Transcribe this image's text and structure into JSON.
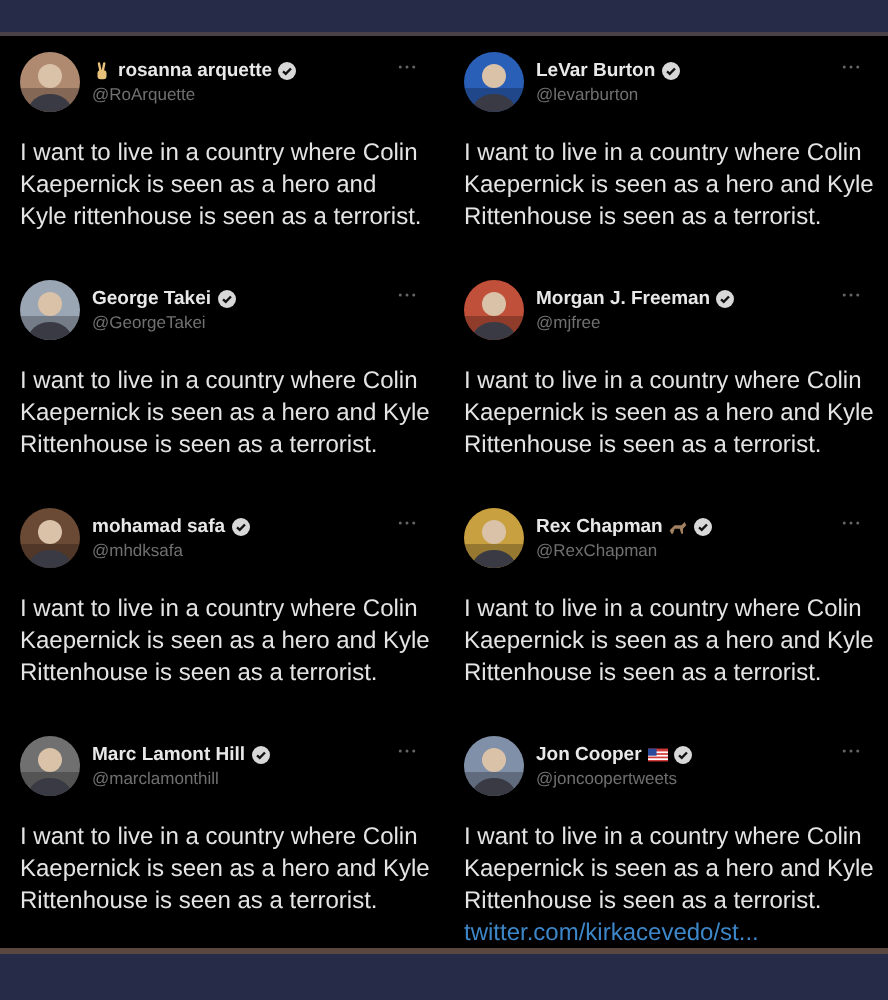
{
  "tweets": [
    {
      "kind": "peace",
      "name": "rosanna arquette",
      "handle": "@RoArquette",
      "text": "I want to live in a country where Colin\nKaepernick  is seen as a hero and\nKyle rittenhouse is seen as a terrorist."
    },
    {
      "kind": "plain",
      "name": "LeVar Burton",
      "handle": "@levarburton",
      "text": "I want to live in a country where Colin\nKaepernick is seen as a hero and Kyle\nRittenhouse is seen as a terrorist."
    },
    {
      "kind": "plain",
      "name": "George Takei",
      "handle": "@GeorgeTakei",
      "text": "I want to live in a country where Colin\nKaepernick is seen as a hero and Kyle\nRittenhouse is seen as a terrorist."
    },
    {
      "kind": "plain",
      "name": "Morgan J. Freeman",
      "handle": "@mjfree",
      "text": "I want to live in a country where Colin\nKaepernick is seen as a hero and Kyle\nRittenhouse is seen as a terrorist."
    },
    {
      "kind": "plain",
      "name": "mohamad safa",
      "handle": "@mhdksafa",
      "text": "I want to live in a country where Colin\nKaepernick is seen as a hero and Kyle\nRittenhouse is seen as a terrorist."
    },
    {
      "kind": "horse",
      "name": "Rex Chapman",
      "handle": "@RexChapman",
      "text": "I want to live in a country where Colin\nKaepernick is seen as a hero and Kyle\nRittenhouse is seen as a terrorist."
    },
    {
      "kind": "plain",
      "name": "Marc Lamont Hill",
      "handle": "@marclamonthill",
      "text": "I want to live in a country where Colin\nKaepernick is seen as a hero and Kyle\nRittenhouse is seen as a terrorist."
    },
    {
      "kind": "flag",
      "name": "Jon Cooper",
      "handle": "@joncoopertweets",
      "text": "I want to live in a country where Colin\nKaepernick is seen as a hero and Kyle\nRittenhouse is seen as a terrorist.",
      "link": "twitter.com/kirkacevedo/st..."
    }
  ]
}
